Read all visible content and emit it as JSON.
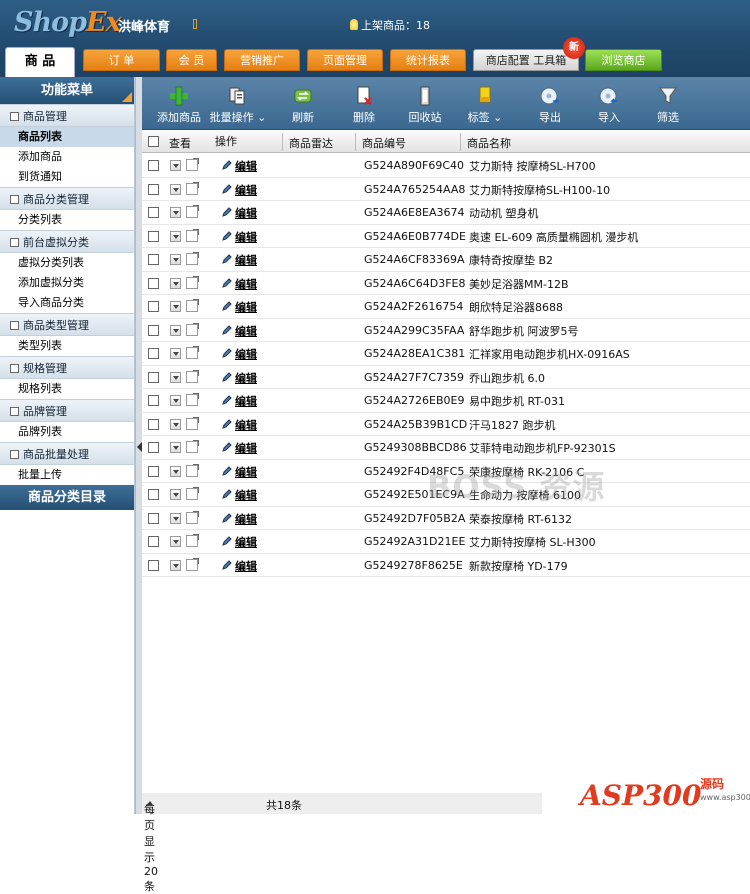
{
  "header": {
    "logo": {
      "part1": "Shop",
      "part2": "Ex"
    },
    "shop_name": "洪峰体育",
    "status": "上架商品：18",
    "tabs": [
      "商 品",
      "订 单",
      "会 员",
      "营销推广",
      "页面管理",
      "统计报表",
      "商店配置 工具箱",
      "浏览商店"
    ],
    "new_badge": "新"
  },
  "sidebar": {
    "title": "功能菜单",
    "groups": [
      {
        "label": "商品管理",
        "items": [
          "商品列表",
          "添加商品",
          "到货通知"
        ]
      },
      {
        "label": "商品分类管理",
        "items": [
          "分类列表"
        ]
      },
      {
        "label": "前台虚拟分类",
        "items": [
          "虚拟分类列表",
          "添加虚拟分类",
          "导入商品分类"
        ]
      },
      {
        "label": "商品类型管理",
        "items": [
          "类型列表"
        ]
      },
      {
        "label": "规格管理",
        "items": [
          "规格列表"
        ]
      },
      {
        "label": "品牌管理",
        "items": [
          "品牌列表"
        ]
      },
      {
        "label": "商品批量处理",
        "items": [
          "批量上传"
        ]
      }
    ],
    "selected_item": "商品列表",
    "bottom": "商品分类目录"
  },
  "toolbar": [
    {
      "label": "添加商品",
      "icon": "plus-icon"
    },
    {
      "label": "批量操作",
      "icon": "batch-icon"
    },
    {
      "label": "刷新",
      "icon": "refresh-icon"
    },
    {
      "label": "删除",
      "icon": "delete-icon"
    },
    {
      "label": "回收站",
      "icon": "recycle-icon"
    },
    {
      "label": "标签",
      "icon": "tag-icon"
    },
    {
      "label": "导出",
      "icon": "export-icon"
    },
    {
      "label": "导入",
      "icon": "import-icon"
    },
    {
      "label": "筛选",
      "icon": "filter-icon"
    }
  ],
  "columns": {
    "view": "查看",
    "ops": "操作",
    "radar": "商品雷达",
    "code": "商品编号",
    "name": "商品名称"
  },
  "edit_label": "编辑",
  "rows": [
    {
      "code": "G524A890F69C40",
      "name": "艾力斯特 按摩椅SL-H700"
    },
    {
      "code": "G524A765254AA8",
      "name": "艾力斯特按摩椅SL-H100-10"
    },
    {
      "code": "G524A6E8EA3674",
      "name": "动动机 塑身机"
    },
    {
      "code": "G524A6E0B774DE",
      "name": "奥速 EL-609 高质量椭圆机 漫步机"
    },
    {
      "code": "G524A6CF83369A",
      "name": "康特奇按摩垫 B2"
    },
    {
      "code": "G524A6C64D3FE8",
      "name": "美妙足浴器MM-12B"
    },
    {
      "code": "G524A2F2616754",
      "name": "朗欣特足浴器8688"
    },
    {
      "code": "G524A299C35FAA",
      "name": "舒华跑步机 阿波罗5号"
    },
    {
      "code": "G524A28EA1C381",
      "name": "汇祥家用电动跑步机HX-0916AS"
    },
    {
      "code": "G524A27F7C7359",
      "name": "乔山跑步机 6.0"
    },
    {
      "code": "G524A2726EB0E9",
      "name": "易中跑步机 RT-031"
    },
    {
      "code": "G524A25B39B1CD",
      "name": "汗马1827 跑步机"
    },
    {
      "code": "G5249308BBCD86",
      "name": "艾菲特电动跑步机FP-92301S"
    },
    {
      "code": "G52492F4D48FC5",
      "name": "荣康按摩椅 RK-2106 C"
    },
    {
      "code": "G52492E501EC9A",
      "name": "生命动力 按摩椅 6100"
    },
    {
      "code": "G52492D7F05B2A",
      "name": "荣泰按摩椅 RT-6132"
    },
    {
      "code": "G52492A31D21EE",
      "name": "艾力斯特按摩椅 SL-H300"
    },
    {
      "code": "G5249278F8625E",
      "name": "新款按摩椅 YD-179"
    }
  ],
  "footer": {
    "per_page": "每页显示20条",
    "total": "共18条"
  },
  "watermark": "BOSS 资源",
  "asp_logo": {
    "main": "ASP300",
    "side": "源码",
    "url": "www.asp300.com"
  }
}
